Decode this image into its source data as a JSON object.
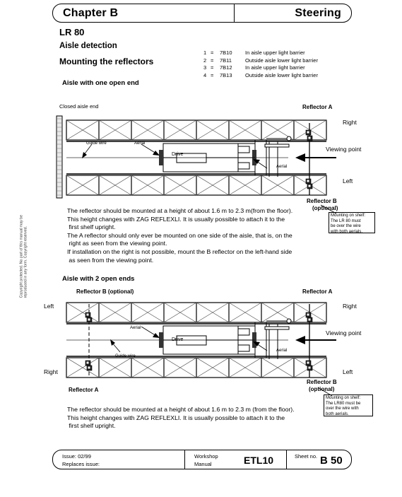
{
  "header": {
    "chapter": "Chapter B",
    "section": "Steering"
  },
  "titles": {
    "model": "LR 80",
    "topic": "Aisle detection",
    "task": "Mounting the reflectors",
    "figure1_caption": "Aisle with one open end",
    "figure2_caption": "Aisle with 2 open ends"
  },
  "legend": [
    {
      "num": "1",
      "eq": "=",
      "code": "7B10",
      "desc": "In aisle upper light barrier"
    },
    {
      "num": "2",
      "eq": "=",
      "code": "7B11",
      "desc": "Outside aisle lower light barrier"
    },
    {
      "num": "3",
      "eq": "=",
      "code": "7B12",
      "desc": "In aisle upper light barrier"
    },
    {
      "num": "4",
      "eq": "=",
      "code": "7B13",
      "desc": "Outside aisle lower light barrier"
    }
  ],
  "figure1": {
    "closed_end": "Closed aisle end",
    "reflector_a": "Reflector A",
    "reflector_b": "Reflector B",
    "reflector_b_optional": "(optional)",
    "side_right": "Right",
    "side_left": "Left",
    "viewing_point": "Viewing point",
    "guide_wire": "Guide wire",
    "aerial_top": "Aerial",
    "aerial_bottom": "Aerial",
    "drive": "Drive",
    "callout": "Mounting on shelf:\nThe LR 80 must\nbe over the wire\nwith both aerials."
  },
  "figure2": {
    "reflector_b_top": "Reflector B (optional)",
    "reflector_a_top": "Reflector A",
    "reflector_a_bottom": "Reflector A",
    "reflector_b_bottom": "Reflector B",
    "reflector_b_bottom_optional": "(optional)",
    "side_left_top": "Left",
    "side_right_top": "Right",
    "side_right_bottom": "Right",
    "side_left_bottom": "Left",
    "viewing_point": "Viewing point",
    "guide_wire": "Guide wire",
    "aerial_top": "Aerial",
    "aerial_bottom": "Aerial",
    "drive": "Drive",
    "callout": "Mounting on shelf:\nThe LR80 must be\nover the wire with\nboth aerials."
  },
  "body1": "The reflector should be mounted at a height of about 1.6 m to 2.3 m(from the floor).\nThis height changes with ZAG REFLEXLI. It is usually possible to attach it to the\n first shelf upright.\nThe A reflector should only ever be mounted on one side of the aisle, that is, on the\n right as seen from the viewing point.\nIf installation on the right is not possible, mount the B reflector on the left-hand side\n as seen from the viewing point.",
  "body2": "The reflector should be mounted at a height of about 1.6 m to 2.3 m (from the floor).\nThis height changes with ZAG REFLEXLI. It is usually possible to attach it to the\n first shelf upright.",
  "footer": {
    "issue": "Issue:   02/99",
    "replaces": "Replaces issue:",
    "workshop": "Workshop",
    "manual": "Manual",
    "etl": "ETL10",
    "sheet_label": "Sheet no.",
    "sheet_no": "B 50"
  },
  "copyright": "Copyright protected. No part of this manual may be reproduced in any form. Copyright reserved."
}
